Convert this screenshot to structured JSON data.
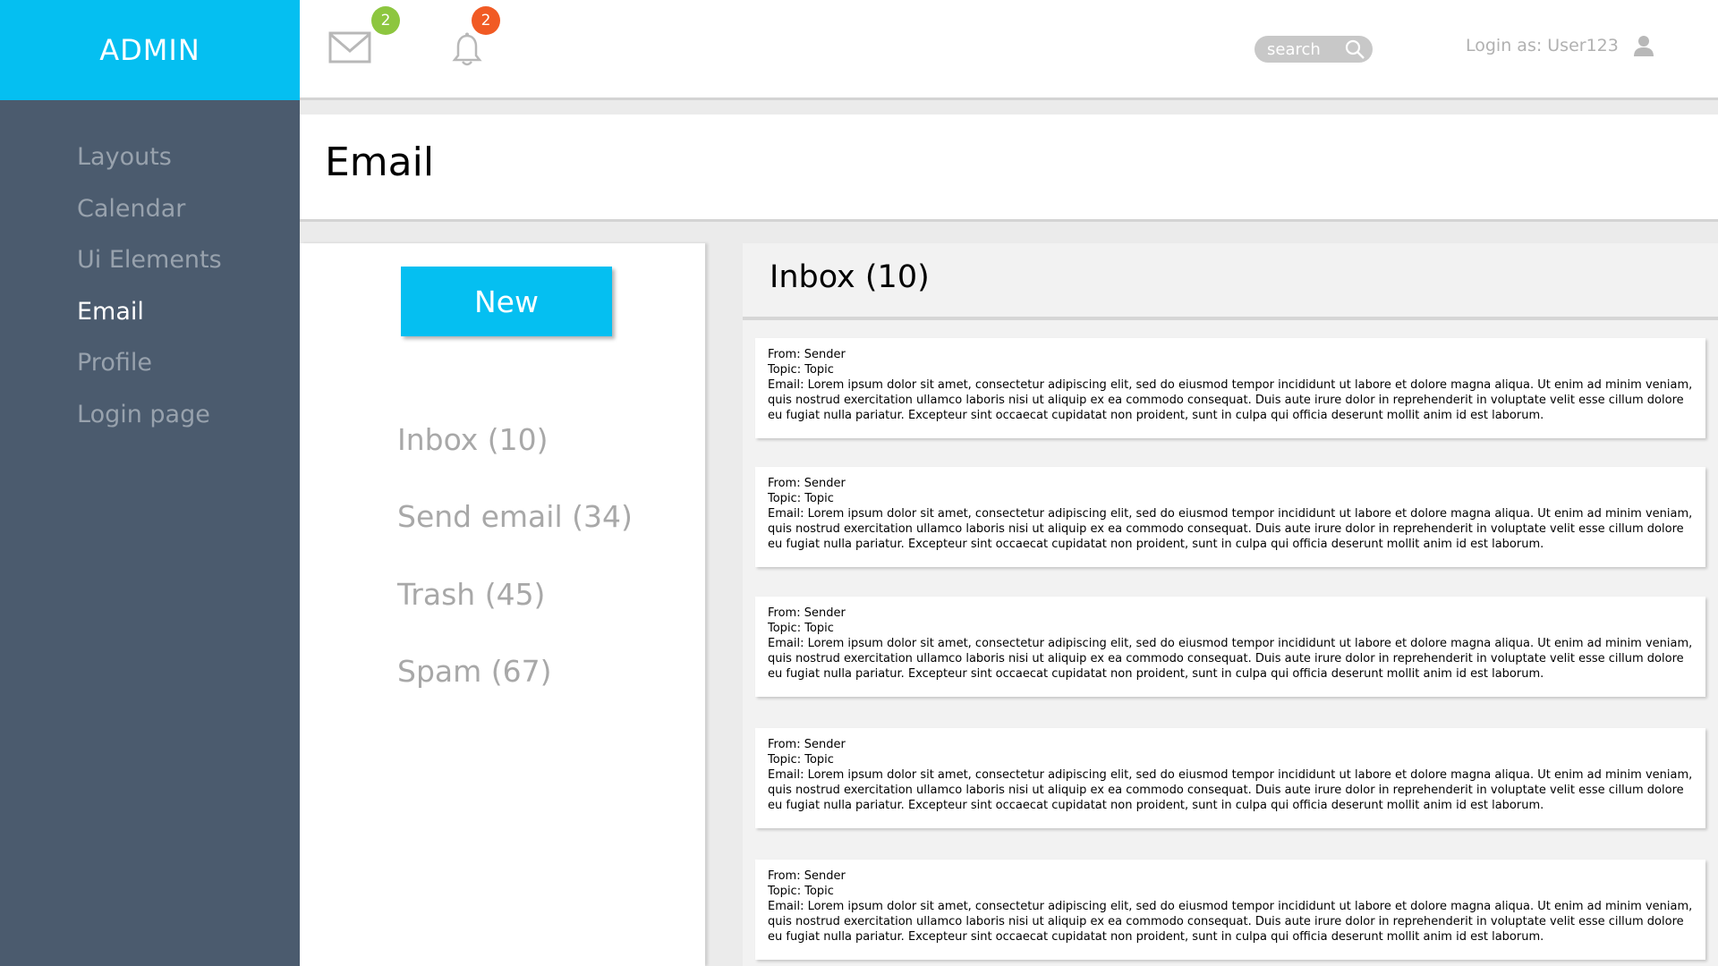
{
  "brand": "ADMIN",
  "nav": {
    "items": [
      {
        "label": "Layouts"
      },
      {
        "label": "Calendar"
      },
      {
        "label": "Ui Elements"
      },
      {
        "label": "Email",
        "active": true
      },
      {
        "label": "Profile"
      },
      {
        "label": "Login page"
      }
    ]
  },
  "topbar": {
    "mail_badge": "2",
    "bell_badge": "2",
    "search_placeholder": "search",
    "login_text": "Login as: User123",
    "icons": [
      "mail-icon",
      "bell-icon",
      "search-icon",
      "user-icon"
    ]
  },
  "colors": {
    "accent": "#05bff1",
    "sidebar": "#4b5b6e",
    "mail_badge": "#8dc63f",
    "bell_badge": "#f15a24"
  },
  "page": {
    "title": "Email"
  },
  "folders": {
    "new_label": "New",
    "items": [
      {
        "label": "Inbox (10)"
      },
      {
        "label": "Send email (34)"
      },
      {
        "label": "Trash (45)"
      },
      {
        "label": "Spam (67)"
      }
    ]
  },
  "inbox": {
    "title": "Inbox (10)",
    "messages": [
      {
        "from": "From: Sender",
        "topic": "Topic: Topic",
        "body": "Email: Lorem ipsum dolor sit amet, consectetur adipiscing elit, sed do eiusmod tempor incididunt ut labore et dolore magna aliqua. Ut enim ad minim veniam, quis nostrud exercitation ullamco laboris nisi ut aliquip ex ea commodo consequat. Duis aute irure dolor in reprehenderit in voluptate velit esse cillum dolore eu fugiat nulla pariatur. Excepteur sint occaecat cupidatat non proident, sunt in culpa qui officia deserunt mollit anim id est laborum."
      },
      {
        "from": "From: Sender",
        "topic": "Topic: Topic",
        "body": "Email: Lorem ipsum dolor sit amet, consectetur adipiscing elit, sed do eiusmod tempor incididunt ut labore et dolore magna aliqua. Ut enim ad minim veniam, quis nostrud exercitation ullamco laboris nisi ut aliquip ex ea commodo consequat. Duis aute irure dolor in reprehenderit in voluptate velit esse cillum dolore eu fugiat nulla pariatur. Excepteur sint occaecat cupidatat non proident, sunt in culpa qui officia deserunt mollit anim id est laborum."
      },
      {
        "from": "From: Sender",
        "topic": "Topic: Topic",
        "body": "Email: Lorem ipsum dolor sit amet, consectetur adipiscing elit, sed do eiusmod tempor incididunt ut labore et dolore magna aliqua. Ut enim ad minim veniam, quis nostrud exercitation ullamco laboris nisi ut aliquip ex ea commodo consequat. Duis aute irure dolor in reprehenderit in voluptate velit esse cillum dolore eu fugiat nulla pariatur. Excepteur sint occaecat cupidatat non proident, sunt in culpa qui officia deserunt mollit anim id est laborum."
      },
      {
        "from": "From: Sender",
        "topic": "Topic: Topic",
        "body": "Email: Lorem ipsum dolor sit amet, consectetur adipiscing elit, sed do eiusmod tempor incididunt ut labore et dolore magna aliqua. Ut enim ad minim veniam, quis nostrud exercitation ullamco laboris nisi ut aliquip ex ea commodo consequat. Duis aute irure dolor in reprehenderit in voluptate velit esse cillum dolore eu fugiat nulla pariatur. Excepteur sint occaecat cupidatat non proident, sunt in culpa qui officia deserunt mollit anim id est laborum."
      },
      {
        "from": "From: Sender",
        "topic": "Topic: Topic",
        "body": "Email: Lorem ipsum dolor sit amet, consectetur adipiscing elit, sed do eiusmod tempor incididunt ut labore et dolore magna aliqua. Ut enim ad minim veniam, quis nostrud exercitation ullamco laboris nisi ut aliquip ex ea commodo consequat. Duis aute irure dolor in reprehenderit in voluptate velit esse cillum dolore eu fugiat nulla pariatur. Excepteur sint occaecat cupidatat non proident, sunt in culpa qui officia deserunt mollit anim id est laborum."
      }
    ]
  }
}
